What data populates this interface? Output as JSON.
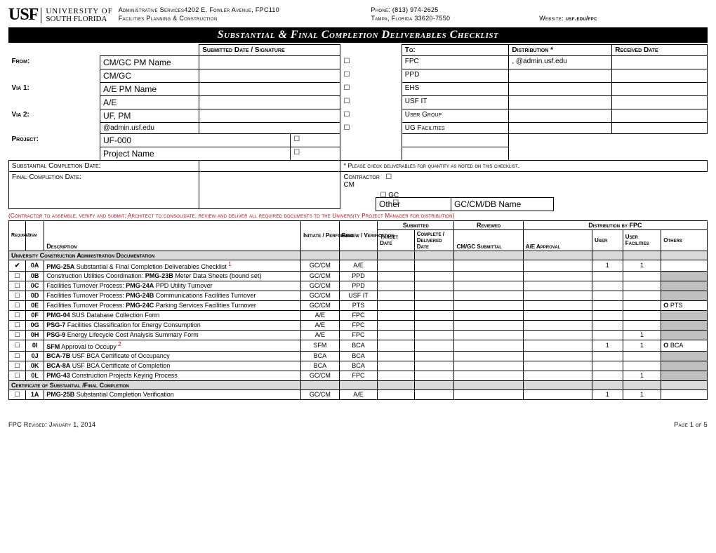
{
  "header": {
    "logo_mark": "USF",
    "logo_line1": "UNIVERSITY OF",
    "logo_line2": "SOUTH FLORIDA",
    "addr1": "Administrative Services4202 E. Fowler Avenue, FPC110",
    "addr2": "Facilities Planning & Construction",
    "phone": "Phone: (813) 974-2625",
    "city": "Tampa, Florida 33620-7550",
    "web_label": "Website:",
    "web": "usf.edu/fpc"
  },
  "title": "Substantial & Final Completion Deliverables Checklist",
  "topHeaders": {
    "submitted": "Submitted Date / Signature",
    "to": "To:",
    "dist": "Distribution *",
    "recv": "Received Date",
    "from": "From:",
    "via1": "Via 1:",
    "via2": "Via 2:",
    "project": "Project:",
    "sub_comp": "Substantial Completion Date:",
    "final_comp": "Final Completion Date:",
    "note": "* Please check deliverables for quantity as noted on this checklist.",
    "contractor": "Contractor",
    "cm": "CM",
    "gc": "GC",
    "other": "Other"
  },
  "topData": {
    "from1": "CM/GC PM Name",
    "from2": "CM/GC",
    "via1a": "A/E PM Name",
    "via1b": "A/E",
    "via2a": "UF, PM",
    "via2b": "@admin.usf.edu",
    "proj1": "UF-000",
    "proj2": "Project Name",
    "to_list": [
      "FPC",
      "PPD",
      "EHS",
      "USF IT",
      "User Group",
      "UG Facilities"
    ],
    "dist1": ", @admin.usf.edu",
    "gccm": "GC/CM/DB Name"
  },
  "red_note": "(Contractor to assemble, verify and submit; Architect to consolidate, review and deliver all required documents to the University Project Manager for distribution)",
  "cols": {
    "req": "Required",
    "item": "Item",
    "desc": "Description",
    "init": "Initiate / Performed",
    "rev": "Review / Verification",
    "submitted": "Submitted",
    "reviewed": "Reviewed",
    "distfpc": "Distribution by FPC",
    "target": "Target Date",
    "complete": "Complete / Delivered Date",
    "cmgc": "CM/GC Submittal",
    "ae": "A/E Approval",
    "user": "User",
    "userfac": "User Facilities",
    "others": "Others"
  },
  "sections": [
    {
      "title": "University Construction Administration Documentation"
    },
    {
      "title": "Certificate of Substantial /Final Completion"
    }
  ],
  "rows": [
    {
      "chk": "✔",
      "id": "0A",
      "desc": "<b>PMG-25A</b>  Substantial & Final Completion Deliverables Checklist <sup>1</sup>",
      "init": "GC/CM",
      "rev": "A/E",
      "u": "1",
      "uf": "1"
    },
    {
      "chk": "☐",
      "id": "0B",
      "desc": "Construction Utilities Coordination:   <b>PMG-23B</b>  Meter Data Sheets (bound set)",
      "init": "GC/CM",
      "rev": "PPD",
      "gray": true
    },
    {
      "chk": "☐",
      "id": "0C",
      "desc": "Facilities Turnover Process:   <b>PMG-24A</b>  PPD Utility Turnover",
      "init": "GC/CM",
      "rev": "PPD",
      "gray": true
    },
    {
      "chk": "☐",
      "id": "0D",
      "desc": "Facilities Turnover Process:   <b>PMG-24B</b>  Communications Facilities Turnover",
      "init": "GC/CM",
      "rev": "USF IT",
      "gray": true
    },
    {
      "chk": "☐",
      "id": "0E",
      "desc": "Facilities Turnover Process:   <b>PMG-24C</b>  Parking Services Facilities Turnover",
      "init": "GC/CM",
      "rev": "PTS",
      "gray": true,
      "oth": "<b>O</b> PTS"
    },
    {
      "chk": "☐",
      "id": "0F",
      "desc": "<b>PMG-04</b>  SUS Database Collection Form",
      "init": "A/E",
      "rev": "FPC",
      "gray": true
    },
    {
      "chk": "☐",
      "id": "0G",
      "desc": "<b>PSG-7</b>  Facilities Classification for Energy Consumption",
      "init": "A/E",
      "rev": "FPC",
      "gray": true
    },
    {
      "chk": "☐",
      "id": "0H",
      "desc": "<b>PSG-9</b>  Energy Lifecycle Cost Analysis Summary Form",
      "init": "A/E",
      "rev": "FPC",
      "gray": true,
      "uf": "1"
    },
    {
      "chk": "☐",
      "id": "0I",
      "desc": "<b>SFM</b> Approval to Occupy <sup>2</sup>",
      "init": "SFM",
      "rev": "BCA",
      "u": "1",
      "uf": "1",
      "oth": "<b>O</b> BCA"
    },
    {
      "chk": "☐",
      "id": "0J",
      "desc": "<b>BCA-7B</b>  USF BCA Certificate of Occupancy",
      "init": "BCA",
      "rev": "BCA",
      "gray": true
    },
    {
      "chk": "☐",
      "id": "0K",
      "desc": "<b>BCA-8A</b>  USF BCA Certificate of Completion",
      "init": "BCA",
      "rev": "BCA",
      "gray": true
    },
    {
      "chk": "☐",
      "id": "0L",
      "desc": "<b>PMG-43</b>  Construction Projects Keying Process",
      "init": "GC/CM",
      "rev": "FPC",
      "gray": true,
      "uf": "1"
    },
    {
      "chk": "☐",
      "id": "1A",
      "desc": "<b>PMG-25B</b>  Substantial Completion Verification",
      "init": "GC/CM",
      "rev": "A/E",
      "u": "1",
      "uf": "1",
      "sec": 2
    }
  ],
  "footer": {
    "rev": "FPC Revised: January 1, 2014",
    "page": "Page 1 of 5"
  }
}
